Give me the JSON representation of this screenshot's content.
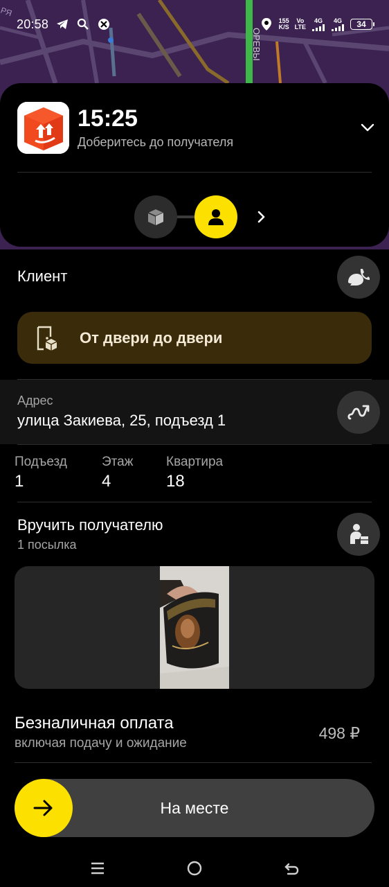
{
  "status_bar": {
    "time": "20:58",
    "speed_value": "155",
    "speed_unit": "K/S",
    "volte_top": "Vo",
    "volte_bottom": "LTE",
    "net1": "4G",
    "net2": "4G",
    "battery": "34"
  },
  "map": {
    "street_label": "ОРЕВЫ",
    "corner_label": "РЯ"
  },
  "header": {
    "eta_time": "15:25",
    "eta_subtitle": "Доберитесь до получателя"
  },
  "client": {
    "label": "Клиент",
    "delivery_type": "От двери до двери"
  },
  "address": {
    "label": "Адрес",
    "value": "улица Закиева, 25, подъезд 1"
  },
  "details": [
    {
      "label": "Подъезд",
      "value": "1"
    },
    {
      "label": "Этаж",
      "value": "4"
    },
    {
      "label": "Квартира",
      "value": "18"
    }
  ],
  "handover": {
    "title": "Вручить получателю",
    "subtitle": "1 посылка"
  },
  "payment": {
    "title": "Безналичная оплата",
    "subtitle": "включая подачу и ожидание",
    "amount": "498 ₽"
  },
  "action": {
    "label": "На месте"
  },
  "colors": {
    "accent_yellow": "#fce000",
    "map_purple": "#3b2251",
    "door_badge_bg": "#3a2c0a",
    "app_icon_orange": "#f24a1f"
  },
  "icons": {
    "telegram": "telegram-icon",
    "search": "search-icon",
    "app_notification": "x-circle-icon",
    "location": "location-pin-icon",
    "package": "package-icon",
    "person": "person-icon",
    "phone": "phone-bubble-icon",
    "route": "route-icon",
    "hand_over": "person-handover-icon",
    "door": "door-package-icon",
    "arrow_right": "arrow-right-icon"
  }
}
